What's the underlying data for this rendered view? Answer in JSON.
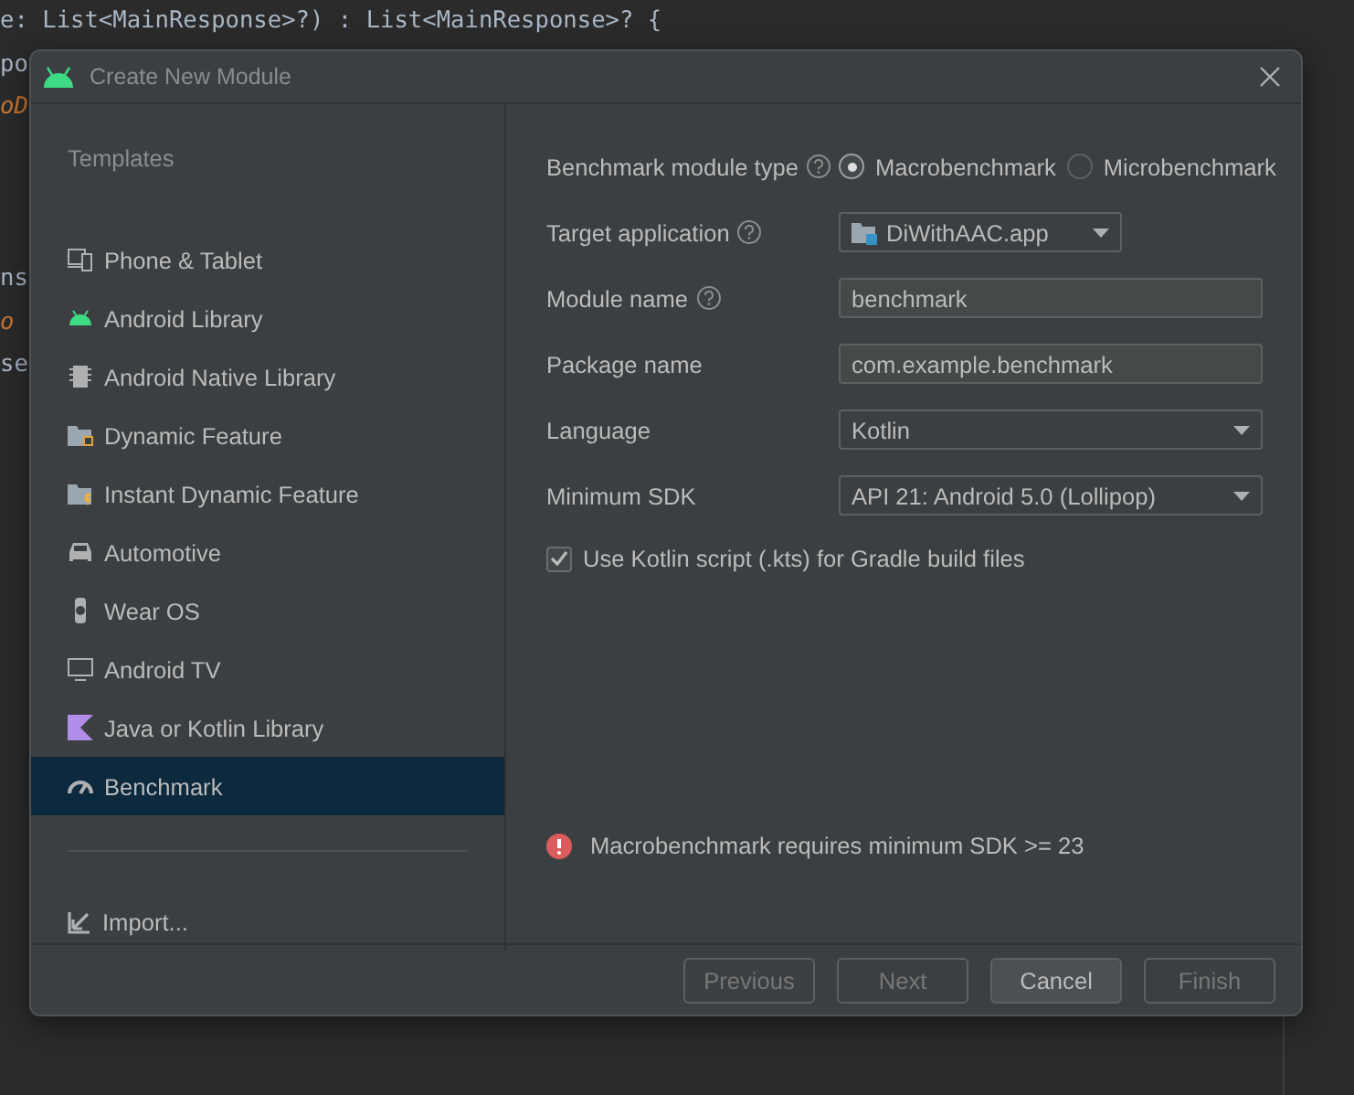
{
  "editor": {
    "lines": [
      {
        "text": "e: List<MainResponse>?) : List<MainResponse>? {",
        "kind": "plain"
      },
      {
        "text": "po",
        "kind": "plain"
      },
      {
        "text": "oD",
        "kind": "keyword"
      },
      {
        "text": "ns",
        "kind": "plain"
      },
      {
        "text": "o",
        "kind": "keyword"
      },
      {
        "text": "se",
        "kind": "plain"
      }
    ]
  },
  "dialog": {
    "title": "Create New Module",
    "sidebar": {
      "heading": "Templates",
      "items": [
        {
          "label": "Phone & Tablet",
          "selected": false
        },
        {
          "label": "Android Library",
          "selected": false
        },
        {
          "label": "Android Native Library",
          "selected": false
        },
        {
          "label": "Dynamic Feature",
          "selected": false
        },
        {
          "label": "Instant Dynamic Feature",
          "selected": false
        },
        {
          "label": "Automotive",
          "selected": false
        },
        {
          "label": "Wear OS",
          "selected": false
        },
        {
          "label": "Android TV",
          "selected": false
        },
        {
          "label": "Java or Kotlin Library",
          "selected": false
        },
        {
          "label": "Benchmark",
          "selected": true
        }
      ],
      "import": "Import..."
    },
    "form": {
      "fields": [
        {
          "kind": "radio",
          "label": "Benchmark module type",
          "help": true,
          "options": [
            {
              "label": "Macrobenchmark",
              "selected": true
            },
            {
              "label": "Microbenchmark",
              "selected": false
            }
          ]
        },
        {
          "kind": "app-select",
          "label": "Target application",
          "help": true,
          "value": "DiWithAAC.app"
        },
        {
          "kind": "text",
          "label": "Module name",
          "help": true,
          "value": "benchmark"
        },
        {
          "kind": "text",
          "label": "Package name",
          "value": "com.example.benchmark"
        },
        {
          "kind": "select",
          "label": "Language",
          "value": "Kotlin"
        },
        {
          "kind": "select",
          "label": "Minimum SDK",
          "value": "API 21: Android 5.0 (Lollipop)"
        }
      ],
      "checkbox": {
        "label": "Use Kotlin script (.kts) for Gradle build files",
        "checked": true
      },
      "error": "Macrobenchmark requires minimum SDK >= 23"
    },
    "buttons": [
      {
        "label": "Previous",
        "disabled": true
      },
      {
        "label": "Next",
        "disabled": true
      },
      {
        "label": "Cancel",
        "disabled": false
      },
      {
        "label": "Finish",
        "disabled": true
      }
    ]
  }
}
